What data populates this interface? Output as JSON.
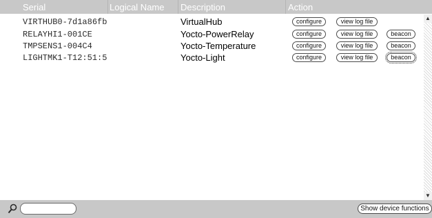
{
  "header": {
    "serial_label": "Serial",
    "logical_name_label": "Logical Name",
    "description_label": "Description",
    "action_label": "Action"
  },
  "devices": [
    {
      "serial": "VIRTHUB0-7d1a86fb",
      "description": "VirtualHub",
      "actions": {
        "configure": "configure",
        "view_log": "view log file"
      }
    },
    {
      "serial": "RELAYHI1-001CE",
      "description": "Yocto-PowerRelay",
      "actions": {
        "configure": "configure",
        "view_log": "view log file",
        "beacon": "beacon"
      }
    },
    {
      "serial": "TMPSENS1-004C4",
      "description": "Yocto-Temperature",
      "actions": {
        "configure": "configure",
        "view_log": "view log file",
        "beacon": "beacon"
      }
    },
    {
      "serial": "LIGHTMK1-T12:51:5",
      "description": "Yocto-Light",
      "actions": {
        "configure": "configure",
        "view_log": "view log file",
        "beacon": "beacon"
      }
    }
  ],
  "footer": {
    "search_value": "",
    "search_icon": "magnifier-icon",
    "show_functions_label": "Show device functions"
  },
  "scrollbar": {
    "up_arrow": "▲",
    "down_arrow": "▼"
  },
  "colors": {
    "header_background": "#c8c8c8",
    "header_text": "#ffffff",
    "button_border": "#4a4a4a"
  }
}
